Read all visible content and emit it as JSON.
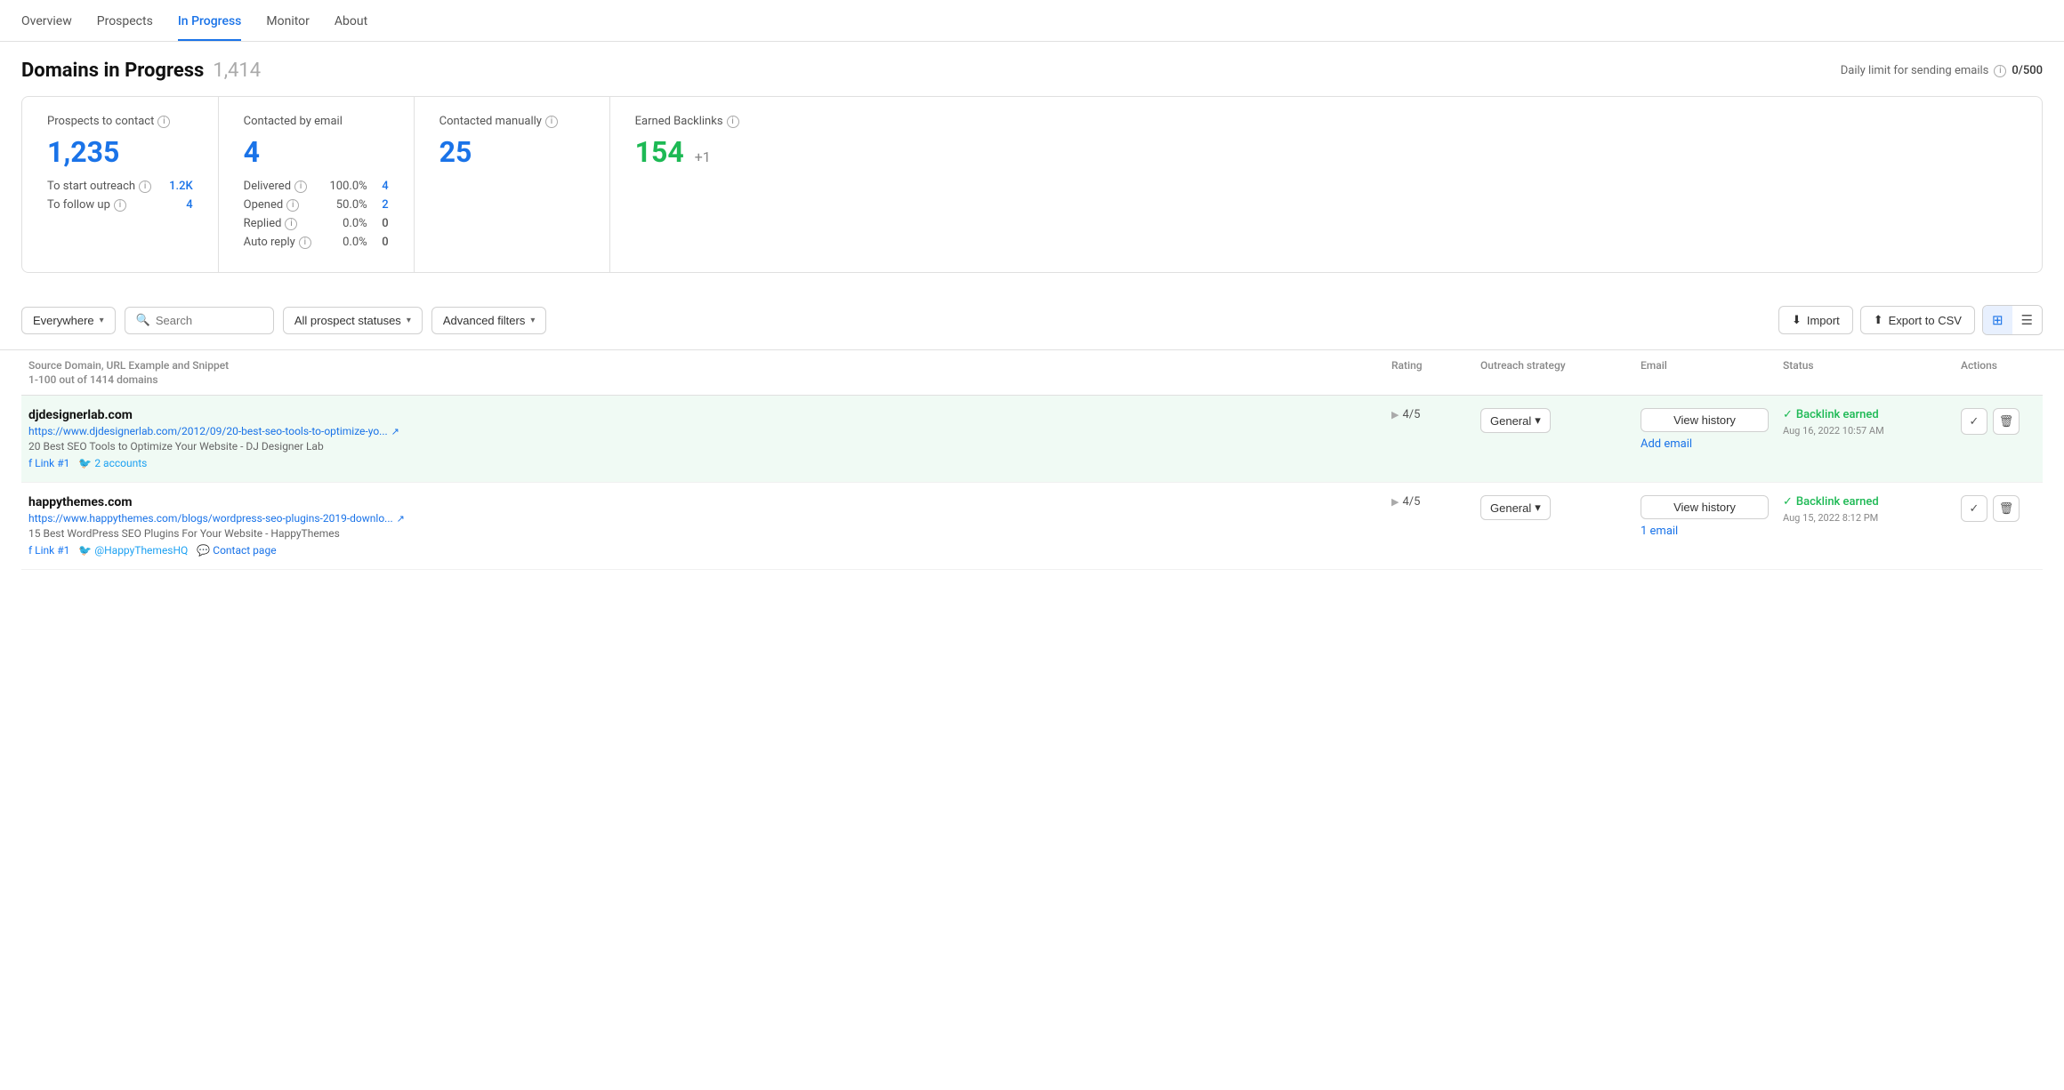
{
  "nav": {
    "items": [
      {
        "id": "overview",
        "label": "Overview",
        "active": false
      },
      {
        "id": "prospects",
        "label": "Prospects",
        "active": false
      },
      {
        "id": "in-progress",
        "label": "In Progress",
        "active": true
      },
      {
        "id": "monitor",
        "label": "Monitor",
        "active": false
      },
      {
        "id": "about",
        "label": "About",
        "active": false
      }
    ]
  },
  "header": {
    "title": "Domains in Progress",
    "count": "1,414",
    "daily_limit_label": "Daily limit for sending emails",
    "daily_limit_value": "0/500"
  },
  "stats": {
    "prospects_to_contact": {
      "label": "Prospects to contact",
      "value": "1,235",
      "rows": [
        {
          "label": "To start outreach",
          "pct": "",
          "value": "1.2K",
          "blue": true
        },
        {
          "label": "To follow up",
          "pct": "",
          "value": "4",
          "blue": true
        }
      ]
    },
    "contacted_by_email": {
      "label": "Contacted by email",
      "value": "4",
      "rows": [
        {
          "label": "Delivered",
          "pct": "100.0%",
          "value": "4",
          "blue": true
        },
        {
          "label": "Opened",
          "pct": "50.0%",
          "value": "2",
          "blue": true
        },
        {
          "label": "Replied",
          "pct": "0.0%",
          "value": "0",
          "blue": false
        },
        {
          "label": "Auto reply",
          "pct": "0.0%",
          "value": "0",
          "blue": false
        }
      ]
    },
    "contacted_manually": {
      "label": "Contacted manually",
      "value": "25"
    },
    "earned_backlinks": {
      "label": "Earned Backlinks",
      "value": "154",
      "suffix": "+1"
    }
  },
  "toolbar": {
    "location_label": "Everywhere",
    "search_placeholder": "Search",
    "status_filter_label": "All prospect statuses",
    "advanced_filters_label": "Advanced filters",
    "import_label": "Import",
    "export_label": "Export to CSV"
  },
  "table": {
    "columns": [
      "Source Domain, URL Example and Snippet",
      "Rating",
      "Outreach strategy",
      "Email",
      "Status",
      "Actions"
    ],
    "subtitle": "1-100 out of 1414 domains",
    "rows": [
      {
        "domain": "djdesignerlab.com",
        "url": "https://www.djdesignerlab.com/2012/09/20-best-seo-tools-to-optimize-yo...",
        "snippet": "20 Best SEO Tools to Optimize Your Website - DJ Designer Lab",
        "fb_link": "Link #1",
        "tw_link": "2 accounts",
        "tw_handle": "",
        "has_contact": false,
        "rating": "4/5",
        "strategy": "General",
        "email_action": "View history",
        "email_secondary": "Add email",
        "status": "Backlink earned",
        "status_date": "Aug 16, 2022 10:57 AM",
        "highlighted": true
      },
      {
        "domain": "happythemes.com",
        "url": "https://www.happythemes.com/blogs/wordpress-seo-plugins-2019-downlo...",
        "snippet": "15 Best WordPress SEO Plugins For Your Website - HappyThemes",
        "fb_link": "Link #1",
        "tw_link": "@HappyThemesHQ",
        "tw_handle": "@HappyThemesHQ",
        "has_contact": true,
        "contact_link": "Contact page",
        "rating": "4/5",
        "strategy": "General",
        "email_action": "View history",
        "email_secondary": "1 email",
        "status": "Backlink earned",
        "status_date": "Aug 15, 2022 8:12 PM",
        "highlighted": false
      }
    ]
  }
}
